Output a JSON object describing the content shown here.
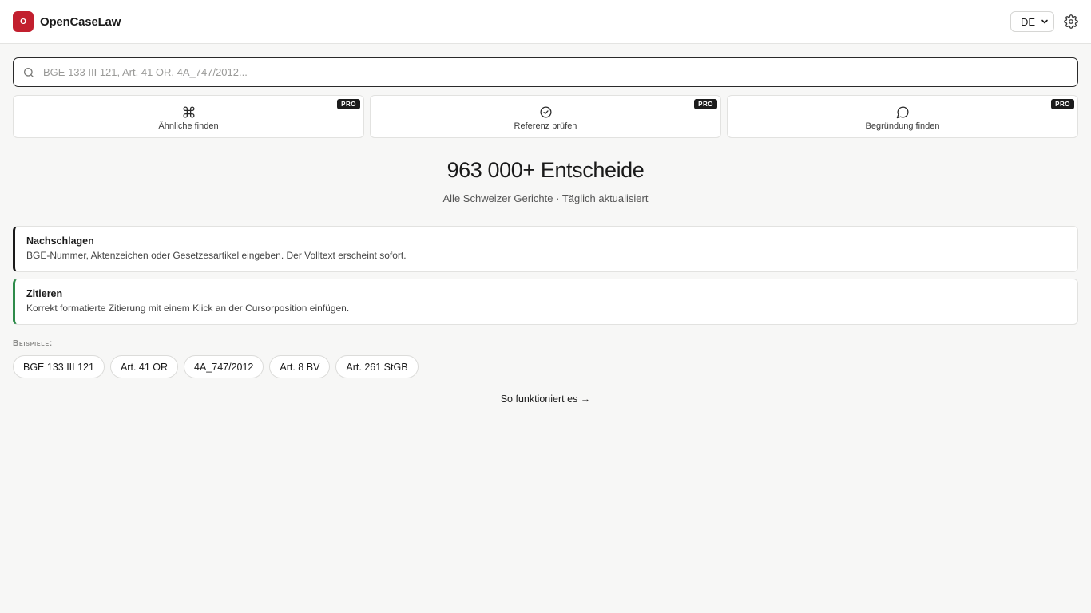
{
  "app": {
    "logo_letter": "O",
    "brand": "OpenCaseLaw",
    "language": "DE"
  },
  "search": {
    "placeholder": "BGE 133 III 121, Art. 41 OR, 4A_747/2012..."
  },
  "tools": [
    {
      "label": "Ähnliche finden",
      "badge": "PRO",
      "icon": "command-icon"
    },
    {
      "label": "Referenz prüfen",
      "badge": "PRO",
      "icon": "check-circle-icon"
    },
    {
      "label": "Begründung finden",
      "badge": "PRO",
      "icon": "message-circle-icon"
    }
  ],
  "hero": {
    "count": "963 000+ Entscheide",
    "subtitle": "Alle Schweizer Gerichte · Täglich aktualisiert"
  },
  "features": [
    {
      "title": "Nachschlagen",
      "description": "BGE-Nummer, Aktenzeichen oder Gesetzesartikel eingeben. Der Volltext erscheint sofort.",
      "accent": "#1a1a1a"
    },
    {
      "title": "Zitieren",
      "description": "Korrekt formatierte Zitierung mit einem Klick an der Cursorposition einfügen.",
      "accent": "#2e8b4a"
    }
  ],
  "examples": {
    "label": "Beispiele:",
    "items": [
      "BGE 133 III 121",
      "Art. 41 OR",
      "4A_747/2012",
      "Art. 8 BV",
      "Art. 261 StGB"
    ]
  },
  "how_link": "So funktioniert es →",
  "colors": {
    "brand": "#c21f2e"
  }
}
